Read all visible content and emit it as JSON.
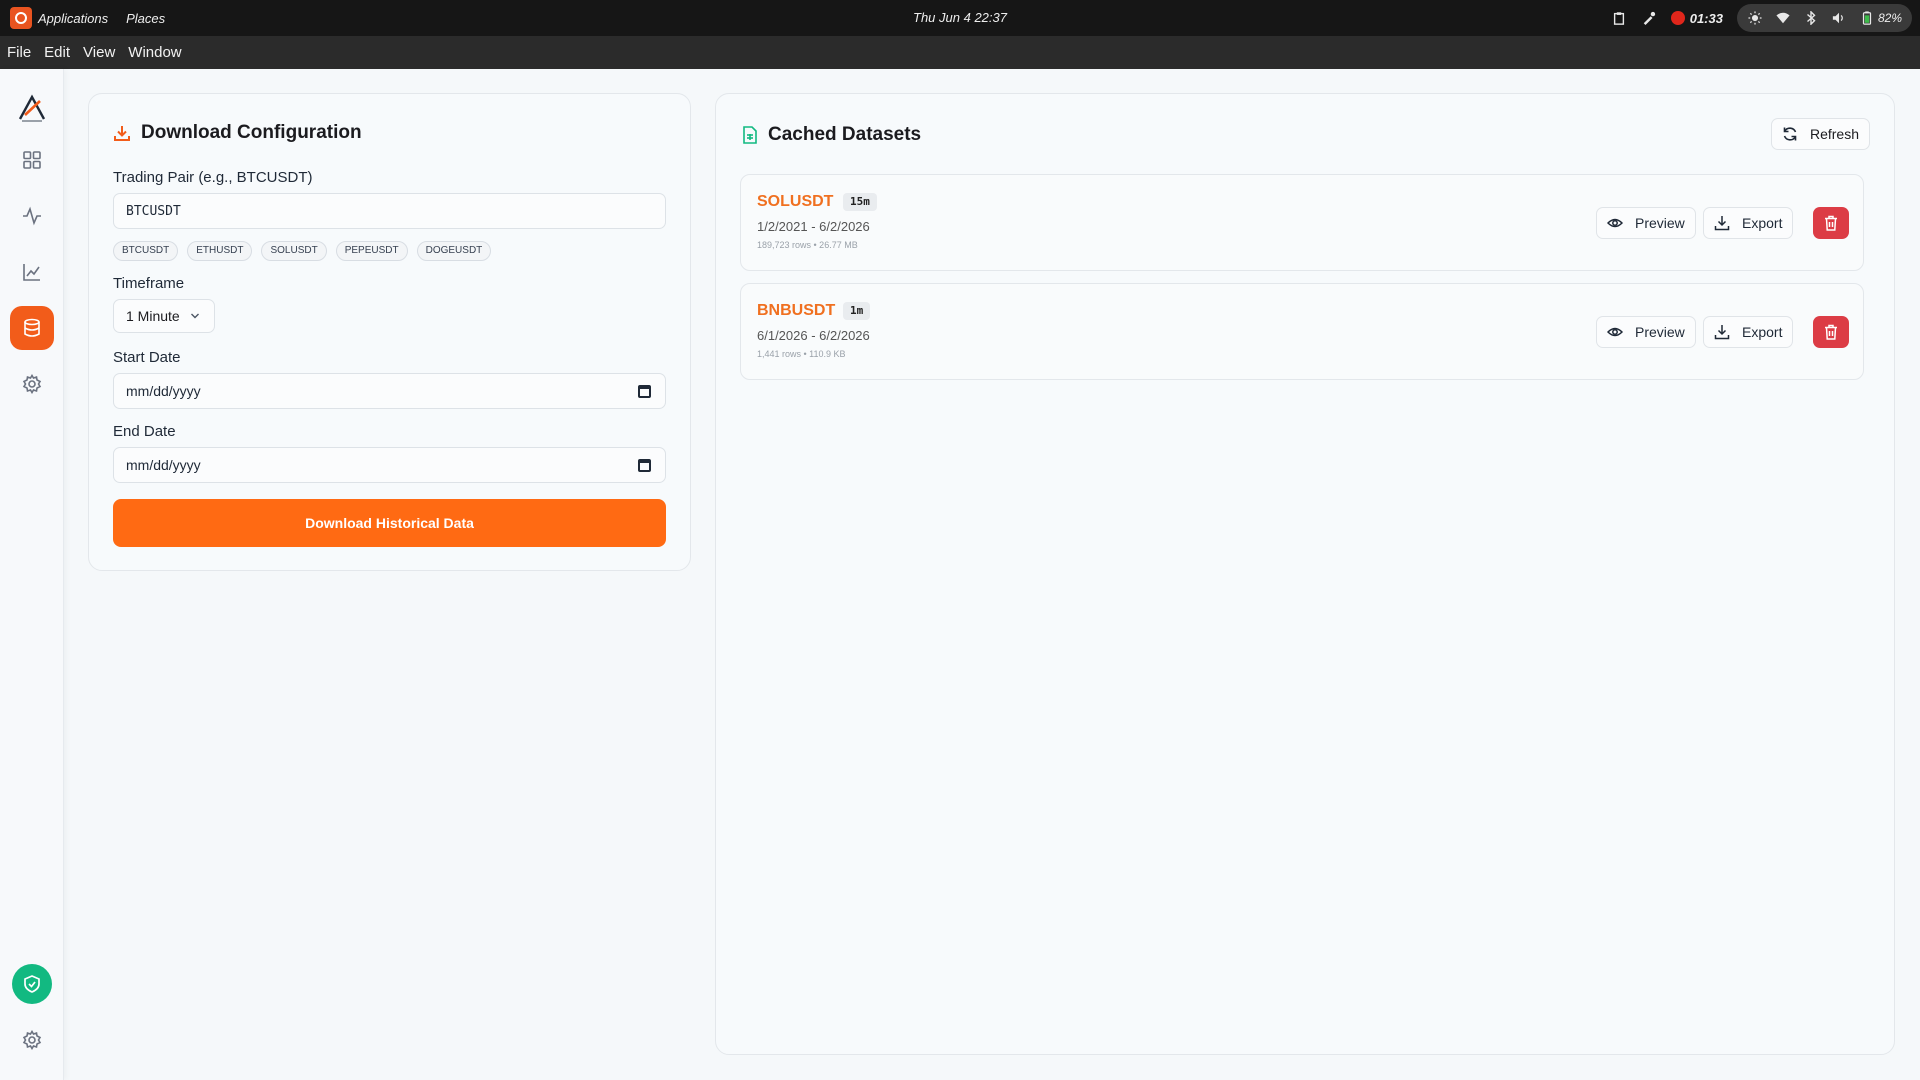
{
  "system": {
    "applications": "Applications",
    "places": "Places",
    "clock": "Thu Jun 4  22:37",
    "recording_time": "01:33",
    "battery": "82%"
  },
  "menubar": {
    "items": [
      "File",
      "Edit",
      "View",
      "Window"
    ]
  },
  "download_config": {
    "title": "Download Configuration",
    "pair_label": "Trading Pair (e.g., BTCUSDT)",
    "pair_value": "BTCUSDT",
    "quick_pairs": [
      "BTCUSDT",
      "ETHUSDT",
      "SOLUSDT",
      "PEPEUSDT",
      "DOGEUSDT"
    ],
    "timeframe_label": "Timeframe",
    "timeframe_value": "1 Minute",
    "start_label": "Start Date",
    "start_placeholder": "mm/dd/yyyy",
    "end_label": "End Date",
    "end_placeholder": "mm/dd/yyyy",
    "download_button": "Download Historical Data"
  },
  "cached": {
    "title": "Cached Datasets",
    "refresh": "Refresh",
    "preview": "Preview",
    "export": "Export",
    "datasets": [
      {
        "symbol": "SOLUSDT",
        "timeframe": "15m",
        "range": "1/2/2021 - 6/2/2026",
        "meta": "189,723 rows • 26.77 MB"
      },
      {
        "symbol": "BNBUSDT",
        "timeframe": "1m",
        "range": "6/1/2026 - 6/2/2026",
        "meta": "1,441 rows • 110.9 KB"
      }
    ]
  },
  "colors": {
    "accent": "#ff6a13",
    "danger": "#dc3c45",
    "success": "#12b981"
  }
}
